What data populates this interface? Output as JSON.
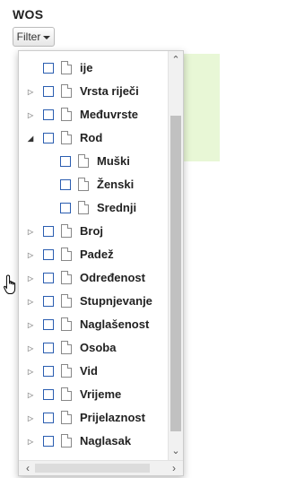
{
  "header": {
    "title": "WOS"
  },
  "filter_button": {
    "label": "Filter",
    "icon": "caret-down-icon"
  },
  "tree": {
    "items": [
      {
        "label": "ije",
        "level": 0,
        "expander": "",
        "checked": false
      },
      {
        "label": "Vrsta riječi",
        "level": 0,
        "expander": "collapsed",
        "checked": false
      },
      {
        "label": "Međuvrste",
        "level": 0,
        "expander": "collapsed",
        "checked": false
      },
      {
        "label": "Rod",
        "level": 0,
        "expander": "expanded",
        "checked": false
      },
      {
        "label": "Muški",
        "level": 1,
        "expander": "",
        "checked": false
      },
      {
        "label": "Ženski",
        "level": 1,
        "expander": "",
        "checked": false
      },
      {
        "label": "Srednji",
        "level": 1,
        "expander": "",
        "checked": false
      },
      {
        "label": "Broj",
        "level": 0,
        "expander": "collapsed",
        "checked": false
      },
      {
        "label": "Padež",
        "level": 0,
        "expander": "collapsed",
        "checked": false
      },
      {
        "label": "Određenost",
        "level": 0,
        "expander": "collapsed",
        "checked": false
      },
      {
        "label": "Stupnjevanje",
        "level": 0,
        "expander": "collapsed",
        "checked": false
      },
      {
        "label": "Naglašenost",
        "level": 0,
        "expander": "collapsed",
        "checked": false
      },
      {
        "label": "Osoba",
        "level": 0,
        "expander": "collapsed",
        "checked": false
      },
      {
        "label": "Vid",
        "level": 0,
        "expander": "collapsed",
        "checked": false
      },
      {
        "label": "Vrijeme",
        "level": 0,
        "expander": "collapsed",
        "checked": false
      },
      {
        "label": "Prijelaznost",
        "level": 0,
        "expander": "collapsed",
        "checked": false
      },
      {
        "label": "Naglasak",
        "level": 0,
        "expander": "collapsed",
        "checked": false
      }
    ]
  },
  "colors": {
    "checkbox_border": "#2a5db0",
    "background_panel": "#e8f7d6",
    "scroll_thumb": "#c1c1c1"
  },
  "cursor": {
    "icon": "hand-pointer-icon"
  }
}
